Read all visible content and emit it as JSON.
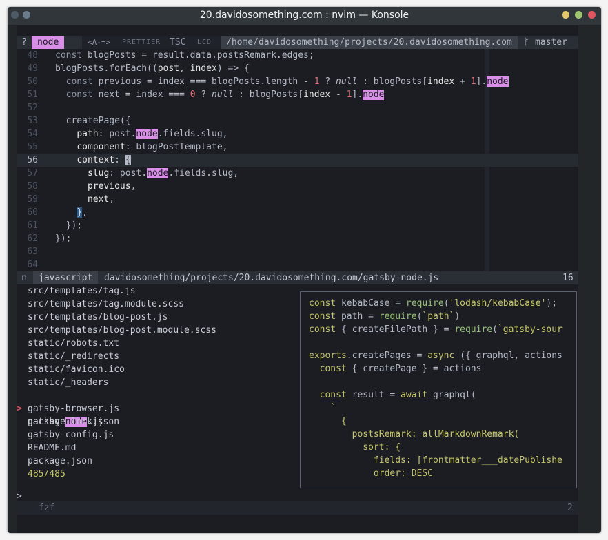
{
  "window": {
    "title": "20.davidosomething.com : nvim — Konsole",
    "colors": {
      "close": "#e0555f",
      "max": "#9ec46f",
      "min": "#e5c76b",
      "accent": "#d98fe8"
    }
  },
  "tabline": {
    "help": "?",
    "buffer": "node",
    "arrow": "<A-=>",
    "prettier": "PRETTIER",
    "tsc": "TSC",
    "lcd": "LCD",
    "cwd": "/home/davidosomething/projects/20.davidosomething.com",
    "branch_icon": "ᚠ",
    "branch": "master"
  },
  "editor": {
    "current_line": "56",
    "lines": [
      {
        "n": "48",
        "t": "  const blogPosts = result.data.postsRemark.edges;"
      },
      {
        "n": "49",
        "t": "  blogPosts.forEach((post, index) => {"
      },
      {
        "n": "50",
        "t": "    const previous = index === blogPosts.length - 1 ? null : blogPosts[index + 1].node"
      },
      {
        "n": "51",
        "t": "    const next = index === 0 ? null : blogPosts[index - 1].node"
      },
      {
        "n": "52",
        "t": ""
      },
      {
        "n": "53",
        "t": "    createPage({"
      },
      {
        "n": "54",
        "t": "      path: post.node.fields.slug,"
      },
      {
        "n": "55",
        "t": "      component: blogPostTemplate,"
      },
      {
        "n": "56",
        "t": "      context: {"
      },
      {
        "n": "57",
        "t": "        slug: post.node.fields.slug,"
      },
      {
        "n": "58",
        "t": "        previous,"
      },
      {
        "n": "59",
        "t": "        next,"
      },
      {
        "n": "60",
        "t": "      },"
      },
      {
        "n": "61",
        "t": "    });"
      },
      {
        "n": "62",
        "t": "  });"
      },
      {
        "n": "63",
        "t": ""
      },
      {
        "n": "64",
        "t": ""
      }
    ]
  },
  "statusline": {
    "mode": "n",
    "filetype": "javascript",
    "path": "davidosomething/projects/20.davidosomething.com/gatsby-node.js",
    "count": "16"
  },
  "fzf": {
    "files": [
      "src/templates/tag.js",
      "src/templates/tag.module.scss",
      "src/templates/blog-post.js",
      "src/templates/blog-post.module.scss",
      "static/robots.txt",
      "static/_redirects",
      "static/favicon.ico",
      "static/_headers",
      "gatsby-node.js",
      "gatsby-browser.js",
      "package-lock.json",
      "gatsby-config.js",
      "README.md",
      "package.json"
    ],
    "selected_index": 8,
    "pointer": ">",
    "counter": "485/485",
    "prompt": ">",
    "label": "fzf",
    "right_num": "2"
  },
  "preview": {
    "lines": [
      "const kebabCase = require('lodash/kebabCase');",
      "const path = require(`path`)",
      "const { createFilePath } = require(`gatsby-sour",
      "",
      "exports.createPages = async ({ graphql, actions",
      "  const { createPage } = actions",
      "",
      "  const result = await graphql(",
      "    `",
      "      {",
      "        postsRemark: allMarkdownRemark(",
      "          sort: {",
      "            fields: [frontmatter___datePublishe",
      "            order: DESC"
    ]
  }
}
